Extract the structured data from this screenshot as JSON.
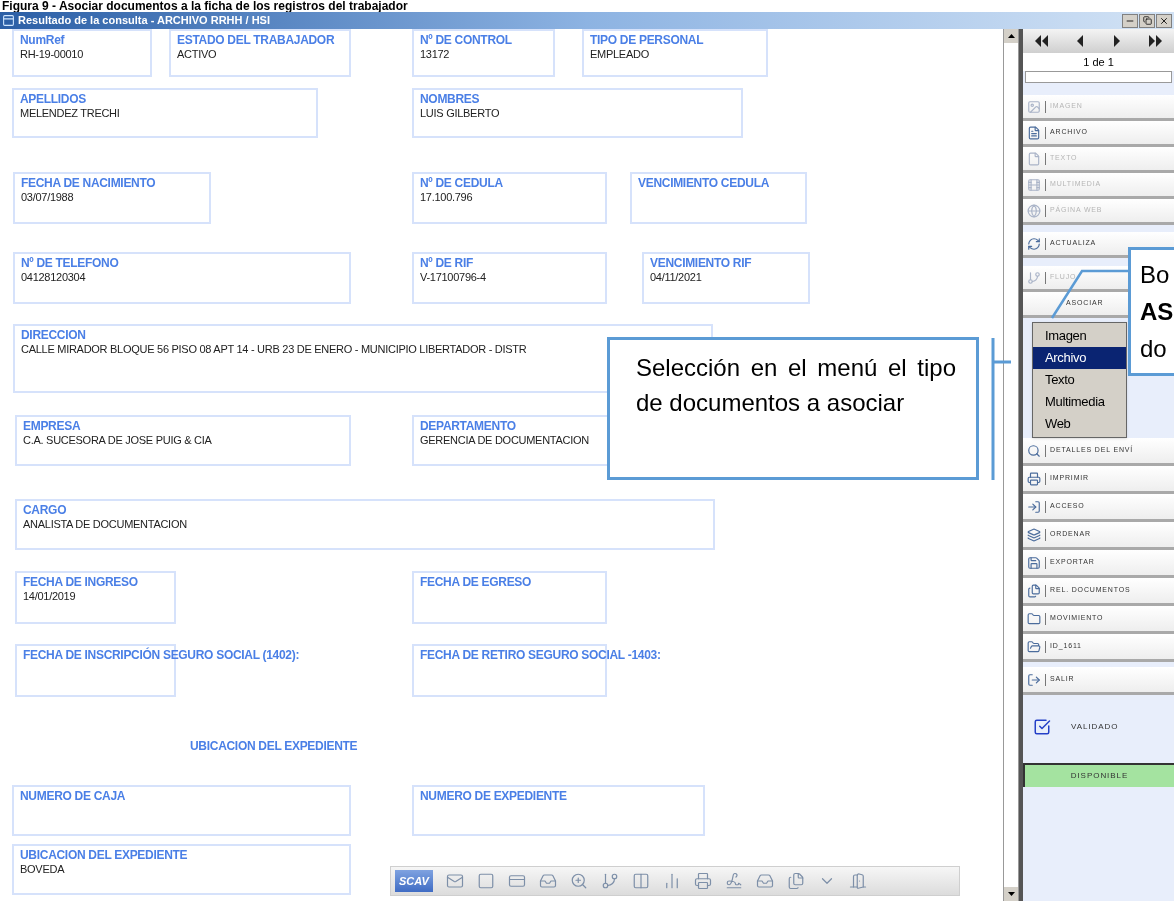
{
  "caption": "Figura 9 - Asociar documentos a la ficha de los registros del trabajador",
  "window": {
    "title": "Resultado de la consulta - ARCHIVO RRHH / HSI"
  },
  "form": {
    "field_lines": [
      [
        {
          "label": "NumRef",
          "value": "RH-19-00010"
        },
        {
          "label": "ESTADO DEL TRABAJADOR",
          "value": "ACTIVO"
        },
        {
          "label": "Nº DE CONTROL",
          "value": "13172"
        },
        {
          "label": "TIPO DE PERSONAL",
          "value": "EMPLEADO"
        }
      ],
      [
        {
          "label": "APELLIDOS",
          "value": "MELENDEZ  TRECHI"
        },
        {
          "label": "NOMBRES",
          "value": "LUIS GILBERTO"
        }
      ],
      [
        {
          "label": "FECHA DE NACIMIENTO",
          "value": "03/07/1988"
        },
        {
          "label": "Nº DE CEDULA",
          "value": "17.100.796"
        },
        {
          "label": "VENCIMIENTO CEDULA"
        }
      ],
      [
        {
          "label": "Nº DE TELEFONO",
          "value": "04128120304"
        },
        {
          "label": "Nº DE RIF",
          "value": "V-17100796-4"
        },
        {
          "label": "VENCIMIENTO RIF",
          "value": "04/11/2021"
        }
      ],
      [
        {
          "label": "DIRECCION",
          "value": "CALLE MIRADOR BLOQUE 56 PISO 08 APT 14 - URB 23 DE ENERO - MUNICIPIO LIBERTADOR - DISTR"
        }
      ],
      [
        {
          "label": "EMPRESA",
          "value": "C.A. SUCESORA DE JOSE PUIG & CIA"
        },
        {
          "label": "DEPARTAMENTO",
          "value": "GERENCIA DE DOCUMENTACION"
        }
      ],
      [
        {
          "label": "CARGO",
          "value": "ANALISTA DE DOCUMENTACION"
        }
      ],
      [
        {
          "label": "FECHA DE INGRESO",
          "value": "14/01/2019"
        },
        {
          "label": "FECHA DE EGRESO"
        }
      ],
      [
        {
          "label": "FECHA DE INSCRIPCIÓN SEGURO SOCIAL (1402):"
        },
        {
          "label": "FECHA DE RETIRO SEGURO SOCIAL -1403:"
        }
      ]
    ],
    "section_heading": "UBICACION DEL EXPEDIENTE",
    "location_lines": [
      [
        {
          "label": "NUMERO DE CAJA"
        },
        {
          "label": "NUMERO DE EXPEDIENTE"
        }
      ],
      [
        {
          "label": "UBICACION DEL EXPEDIENTE",
          "value": "BOVEDA"
        }
      ]
    ]
  },
  "toolbar": {
    "brand": "SCAV"
  },
  "navigator": {
    "page": "1 de 1"
  },
  "panel": {
    "buttons": [
      {
        "label": "IMAGEN",
        "disabled": true
      },
      {
        "label": "ARCHIVO",
        "disabled": false
      },
      {
        "label": "TEXTO",
        "disabled": true
      },
      {
        "label": "MULTIMEDIA",
        "disabled": true
      },
      {
        "label": "PÁGINA WEB",
        "disabled": true
      },
      {
        "label": "ACTUALIZA",
        "disabled": false
      },
      {
        "label": "FLUJO",
        "disabled": true
      },
      {
        "label": "ASOCIAR",
        "disabled": false
      },
      {
        "label": "DETALLES DEL ENVÍ",
        "disabled": false
      },
      {
        "label": "IMPRIMIR",
        "disabled": false
      },
      {
        "label": "ACCESO",
        "disabled": false
      },
      {
        "label": "ORDENAR",
        "disabled": false
      },
      {
        "label": "EXPORTAR",
        "disabled": false
      },
      {
        "label": "REL. DOCUMENTOS",
        "disabled": false
      },
      {
        "label": "MOVIMIENTO",
        "disabled": false
      },
      {
        "label": "ID_1611",
        "disabled": false
      },
      {
        "label": "SALIR",
        "disabled": false
      }
    ],
    "validated": "VALIDADO",
    "availability": "DISPONIBLE"
  },
  "menu": {
    "items": [
      {
        "label": "Imagen",
        "selected": false
      },
      {
        "label": "Archivo",
        "selected": true
      },
      {
        "label": "Texto",
        "selected": false
      },
      {
        "label": "Multimedia",
        "selected": false
      },
      {
        "label": "Web",
        "selected": false
      }
    ]
  },
  "callouts": [
    {
      "text": "Selección en el menú el tipo de documentos a asociar"
    },
    {
      "lines": [
        {
          "text": "Bo",
          "bold": false
        },
        {
          "text": "AS",
          "bold": true
        },
        {
          "text": "do",
          "bold": false
        }
      ]
    }
  ]
}
